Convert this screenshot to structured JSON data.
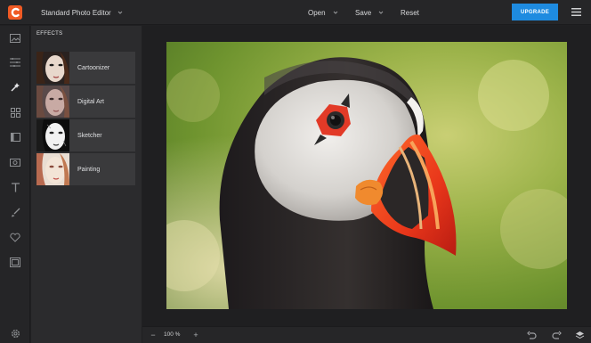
{
  "app": {
    "title": "Standard Photo Editor",
    "logo_icon": "editor-logo-icon",
    "brand_color": "#f05a24"
  },
  "menu": {
    "open_label": "Open",
    "save_label": "Save",
    "reset_label": "Reset"
  },
  "upgrade": {
    "label": "UPGRADE",
    "color": "#1e8be0"
  },
  "rail": {
    "icons": [
      "image-icon",
      "adjust-icon",
      "effects-icon",
      "grid-icon",
      "frame-icon",
      "camera-icon",
      "text-icon",
      "brush-icon",
      "heart-icon",
      "texture-icon",
      "settings-icon"
    ]
  },
  "effects_panel": {
    "title": "EFFECTS",
    "items": [
      {
        "label": "Cartoonizer",
        "thumb": "cartoonizer-thumbnail"
      },
      {
        "label": "Digital Art",
        "thumb": "digital-art-thumbnail"
      },
      {
        "label": "Sketcher",
        "thumb": "sketcher-thumbnail"
      },
      {
        "label": "Painting",
        "thumb": "painting-thumbnail"
      }
    ]
  },
  "canvas": {
    "image": "puffin-photo"
  },
  "bottom_bar": {
    "zoom_minus": "−",
    "zoom_value": "100 %",
    "zoom_plus": "+",
    "icons": [
      "undo-icon",
      "redo-icon",
      "layers-icon"
    ]
  }
}
